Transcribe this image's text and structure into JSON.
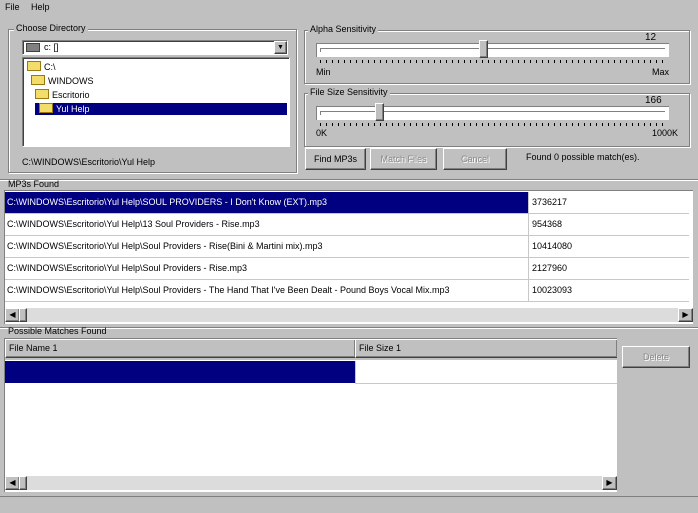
{
  "menu": {
    "file": "File",
    "help": "Help"
  },
  "directory": {
    "title": "Choose Directory",
    "drive": "c: []",
    "tree": [
      {
        "label": "C:\\",
        "level": 0,
        "selected": false
      },
      {
        "label": "WINDOWS",
        "level": 1,
        "selected": false
      },
      {
        "label": "Escritorio",
        "level": 2,
        "selected": false
      },
      {
        "label": "Yul Help",
        "level": 3,
        "selected": true
      }
    ],
    "current_path": "C:\\WINDOWS\\Escritorio\\Yul Help"
  },
  "alpha": {
    "title": "Alpha Sensitivity",
    "value": "12",
    "min_label": "Min",
    "max_label": "Max",
    "level": 0.47
  },
  "filesize": {
    "title": "File Size Sensitivity",
    "value": "166",
    "min_label": "0K",
    "max_label": "1000K",
    "level": 0.17
  },
  "buttons": {
    "find": "Find MP3s",
    "match": "Match Files",
    "cancel": "Cancel",
    "delete": "Delete"
  },
  "status": "Found 0 possible match(es).",
  "mp3s": {
    "title": "MP3s Found",
    "rows": [
      {
        "path": "C:\\WINDOWS\\Escritorio\\Yul Help\\SOUL PROVIDERS - I Don't Know (EXT).mp3",
        "size": "3736217"
      },
      {
        "path": "C:\\WINDOWS\\Escritorio\\Yul Help\\13 Soul Providers - Rise.mp3",
        "size": "954368"
      },
      {
        "path": "C:\\WINDOWS\\Escritorio\\Yul Help\\Soul Providers - Rise(Bini & Martini mix).mp3",
        "size": "10414080"
      },
      {
        "path": "C:\\WINDOWS\\Escritorio\\Yul Help\\Soul Providers - Rise.mp3",
        "size": "2127960"
      },
      {
        "path": "C:\\WINDOWS\\Escritorio\\Yul Help\\Soul Providers - The Hand That I've Been Dealt - Pound Boys Vocal Mix.mp3",
        "size": "10023093"
      }
    ]
  },
  "matches": {
    "title": "Possible Matches Found",
    "col1": "File Name 1",
    "col2": "File Size 1"
  },
  "colors": {
    "face": "#c0c0c0",
    "selection": "#000080"
  }
}
